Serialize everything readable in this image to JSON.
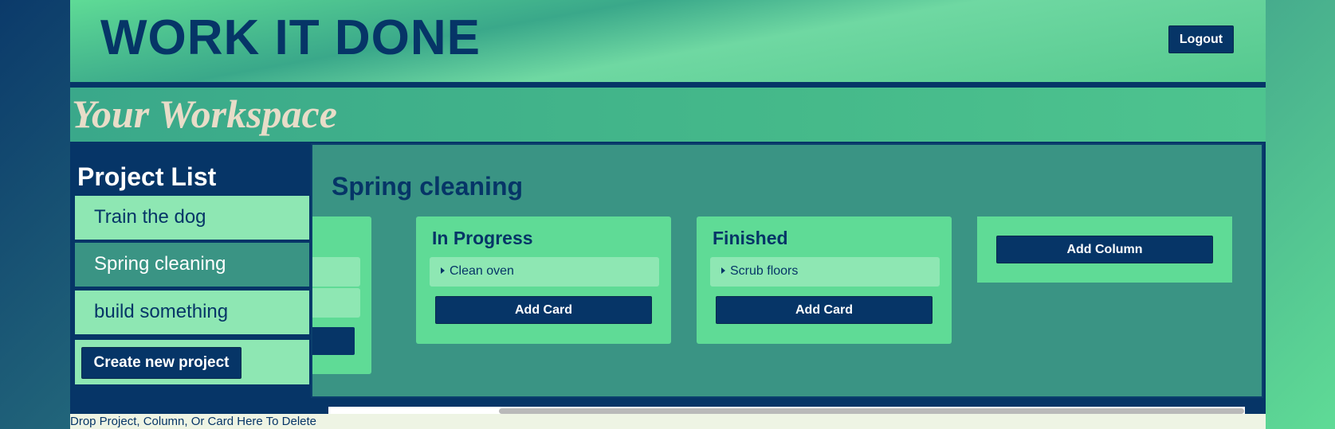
{
  "header": {
    "app_title": "WORK IT DONE",
    "logout_label": "Logout"
  },
  "workspace": {
    "title": "Your Workspace"
  },
  "sidebar": {
    "title": "Project List",
    "projects": [
      {
        "label": "Train the dog",
        "active": false
      },
      {
        "label": "Spring cleaning",
        "active": true
      },
      {
        "label": "build something",
        "active": false
      }
    ],
    "create_label": "Create new project"
  },
  "board": {
    "title": "Spring cleaning",
    "columns": [
      {
        "title": "In Progress",
        "cards": [
          "Clean oven"
        ],
        "add_card_label": "Add Card"
      },
      {
        "title": "Finished",
        "cards": [
          "Scrub floors"
        ],
        "add_card_label": "Add Card"
      }
    ],
    "add_column_label": "Add Column"
  },
  "footer": {
    "drop_zone_text": "Drop Project, Column, Or Card Here To Delete"
  },
  "colors": {
    "navy": "#063567",
    "mint": "#5fdb96",
    "light_mint": "#8ee7b3",
    "teal": "#3a9484",
    "cream": "#e8dcc8"
  }
}
